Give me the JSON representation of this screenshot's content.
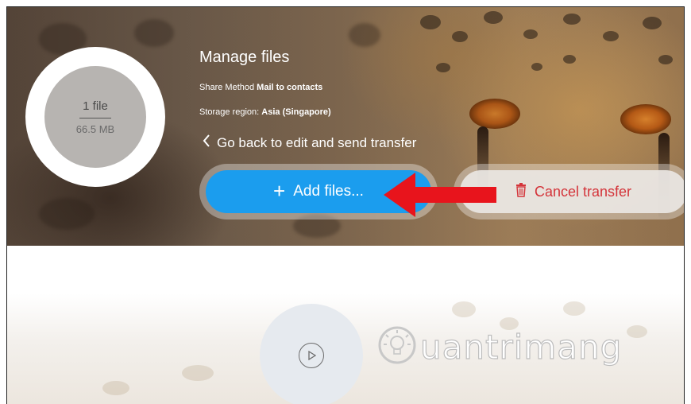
{
  "transfer": {
    "file_count": "1 file",
    "file_size": "66.5 MB",
    "title": "Manage files",
    "share_method_label": "Share Method",
    "share_method_value": "Mail to contacts",
    "storage_region_label": "Storage region:",
    "storage_region_value": "Asia (Singapore)",
    "back_link": "Go back to edit and send transfer"
  },
  "actions": {
    "add_files": "Add files...",
    "add_icon": "plus-icon",
    "cancel_transfer": "Cancel transfer",
    "cancel_icon": "trash-icon"
  },
  "watermark": {
    "text": "uantrimang",
    "icon": "lightbulb-icon"
  },
  "colors": {
    "add_button": "#1b9dee",
    "cancel_text": "#d4343a",
    "annotation_arrow": "#e8141c"
  }
}
